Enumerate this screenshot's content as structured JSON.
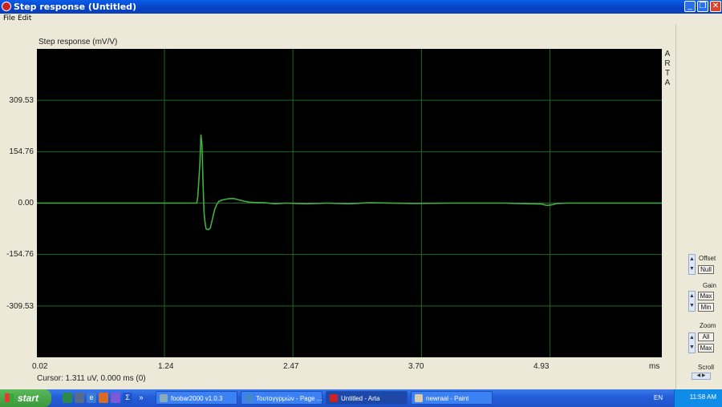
{
  "window": {
    "title": "Step response (Untitled)",
    "controls": [
      "minimize-icon",
      "maximize-icon",
      "close-icon"
    ]
  },
  "menu": [
    "File",
    "Edit"
  ],
  "graph": {
    "title": "Step response (mV/V)",
    "side_label": [
      "A",
      "R",
      "T",
      "A"
    ],
    "cursor_text": "Cursor:  1.311 uV,   0.000 ms  (0)"
  },
  "chart_data": {
    "type": "line",
    "title": "Step response (mV/V)",
    "xlabel": "ms",
    "ylabel": "",
    "xlim": [
      0.02,
      6.0
    ],
    "ylim": [
      -464.3,
      464.3
    ],
    "x_ticks": [
      "0.02",
      "1.24",
      "2.47",
      "3.70",
      "4.93",
      "ms"
    ],
    "y_ticks": [
      "309.53",
      "154.76",
      "0.00",
      "-154.76",
      "-309.53"
    ],
    "grid": true,
    "background": "#000000",
    "line_color": "#3fb23f",
    "grid_color": "#1e6b1e",
    "series": [
      {
        "x": [
          0.02,
          1.55,
          1.56,
          1.58,
          1.59,
          1.6,
          1.61,
          1.62,
          1.63,
          1.64,
          1.66,
          1.68,
          1.7,
          1.72,
          1.74,
          1.76,
          1.78,
          1.8,
          1.85,
          1.9,
          1.95,
          2.0,
          2.05,
          2.1,
          2.2,
          2.3,
          2.4,
          2.6,
          2.8,
          3.0,
          3.2,
          3.6,
          4.0,
          4.5,
          4.85,
          4.9,
          4.95,
          5.0,
          5.1,
          5.4,
          6.0
        ],
        "y": [
          0,
          0,
          20,
          120,
          205,
          175,
          60,
          -30,
          -60,
          -78,
          -80,
          -75,
          -48,
          -20,
          -5,
          5,
          8,
          10,
          13,
          14,
          10,
          6,
          3,
          2,
          1,
          -2,
          0,
          -2,
          0,
          -2,
          1,
          -1,
          0,
          0,
          -3,
          -7,
          -5,
          -1,
          0,
          0,
          0
        ]
      }
    ]
  },
  "controls": {
    "offset": {
      "label": "Offset",
      "buttons": [
        "Null"
      ]
    },
    "gain": {
      "label": "Gain",
      "buttons": [
        "Max",
        "Min"
      ]
    },
    "zoom": {
      "label": "Zoom",
      "buttons": [
        "All",
        "Max"
      ]
    },
    "scroll": {
      "label": "Scroll"
    }
  },
  "taskbar": {
    "start": "start",
    "tasks": [
      {
        "label": "foobar2000 v1.0.3",
        "active": false
      },
      {
        "label": "Τουτογγρμών - Page ...",
        "active": false
      },
      {
        "label": "Untitled - Arta",
        "active": true
      },
      {
        "label": "newraal - Paint",
        "active": false
      }
    ],
    "language": "EN",
    "clock": "11:58 AM"
  }
}
